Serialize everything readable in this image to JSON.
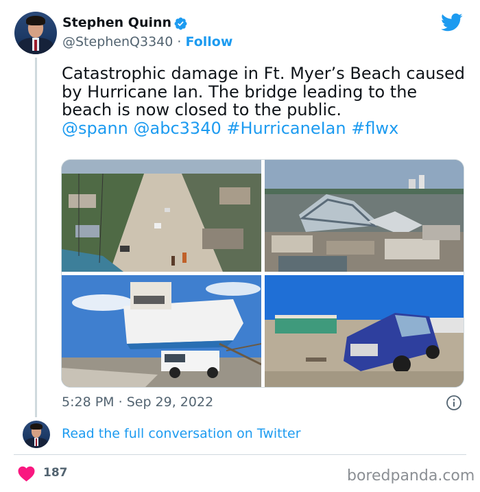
{
  "author": {
    "name": "Stephen Quinn",
    "handle": "@StephenQ3340",
    "separator": "·",
    "follow_label": "Follow"
  },
  "tweet": {
    "text": "Catastrophic damage in Ft. Myer’s Beach caused by Hurricane Ian. The bridge leading to the beach is now closed to the public.",
    "mentions": [
      "@spann",
      "@abc3340",
      "#HurricaneIan",
      "#flwx"
    ],
    "time": "5:28 PM",
    "separator": "·",
    "date": "Sep 29, 2022"
  },
  "media": {
    "photo_count": 4
  },
  "conversation": {
    "read_label": "Read the full conversation on Twitter"
  },
  "engagement": {
    "likes": "187"
  },
  "watermark": "boredpanda.com",
  "colors": {
    "link": "#1d9bf0",
    "secondary_text": "#536471",
    "heart": "#f91880",
    "twitter_blue": "#1d9bf0"
  },
  "icons": {
    "verified": "verified-badge-icon",
    "brand": "twitter-bird-icon",
    "info": "info-icon",
    "like": "heart-icon"
  }
}
